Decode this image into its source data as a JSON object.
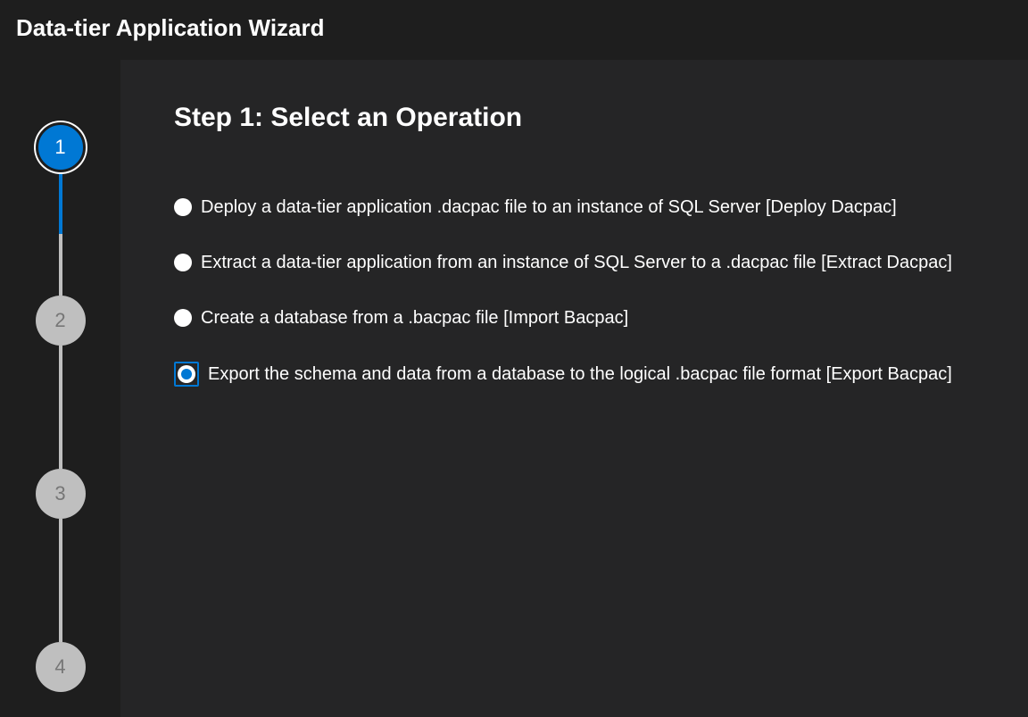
{
  "header": {
    "title": "Data-tier Application Wizard"
  },
  "stepper": {
    "steps": [
      {
        "number": "1",
        "state": "active"
      },
      {
        "number": "2",
        "state": "inactive"
      },
      {
        "number": "3",
        "state": "inactive"
      },
      {
        "number": "4",
        "state": "inactive"
      }
    ]
  },
  "content": {
    "heading": "Step 1: Select an Operation",
    "options": [
      {
        "id": "deploy-dacpac",
        "label": "Deploy a data-tier application .dacpac file to an instance of SQL Server [Deploy Dacpac]",
        "selected": false
      },
      {
        "id": "extract-dacpac",
        "label": "Extract a data-tier application from an instance of SQL Server to a .dacpac file [Extract Dacpac]",
        "selected": false
      },
      {
        "id": "import-bacpac",
        "label": "Create a database from a .bacpac file [Import Bacpac]",
        "selected": false
      },
      {
        "id": "export-bacpac",
        "label": "Export the schema and data from a database to the logical .bacpac file format [Export Bacpac]",
        "selected": true
      }
    ]
  }
}
